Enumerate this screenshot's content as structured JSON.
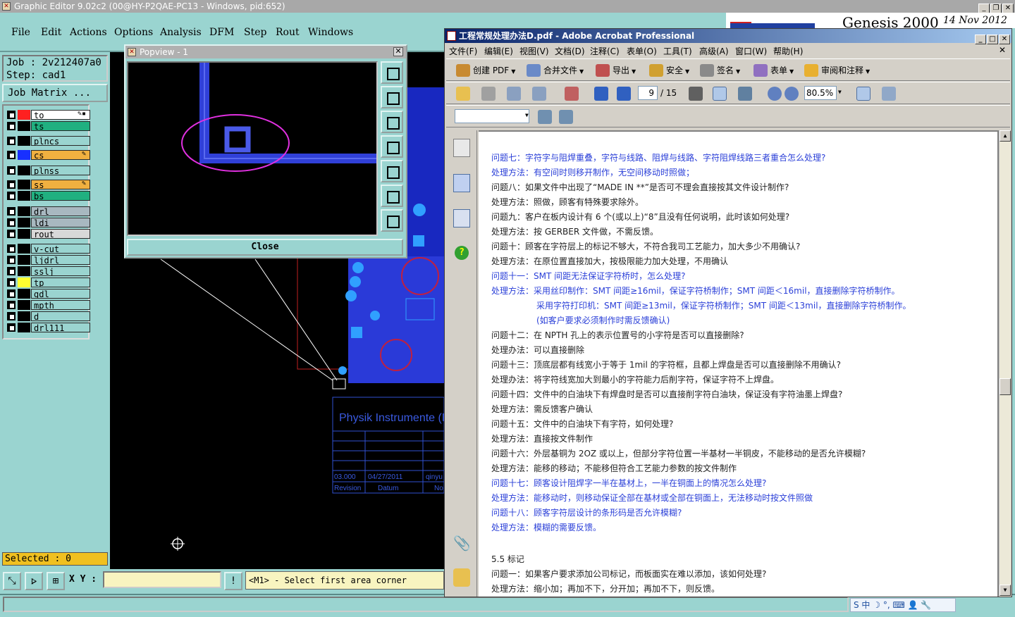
{
  "genesis": {
    "title": "Graphic Editor 9.02c2 (00@HY-P2QAE-PC13 - Windows, pid:652)",
    "menu": [
      "File",
      "Edit",
      "Actions",
      "Options",
      "Analysis",
      "DFM",
      "Step",
      "Rout",
      "Windows"
    ],
    "brand_name": "Genesis 2000",
    "brand_date": "14 Nov 2012",
    "job_label": "Job : 2v212407a0",
    "step_label": "Step: cad1",
    "job_matrix_button": "Job Matrix ...",
    "layers": [
      {
        "name": "to",
        "swatch": "#ff2020",
        "bg": "#ffffff",
        "edit": "✎▪"
      },
      {
        "name": "ts",
        "swatch": "#000000",
        "bg": "#20b080",
        "edit": ""
      },
      {
        "name": "plncs",
        "swatch": "#000000",
        "bg": "#9ad4d0",
        "edit": ""
      },
      {
        "name": "cs",
        "swatch": "#1830ff",
        "bg": "#f0b040",
        "edit": "✎"
      },
      {
        "name": "plnss",
        "swatch": "#000000",
        "bg": "#9ad4d0",
        "edit": ""
      },
      {
        "name": "ss",
        "swatch": "#000000",
        "bg": "#f0b040",
        "edit": "✎"
      },
      {
        "name": "bs",
        "swatch": "#000000",
        "bg": "#20b080",
        "edit": ""
      },
      {
        "name": "drl",
        "swatch": "#000000",
        "bg": "#a8b8c0",
        "edit": ""
      },
      {
        "name": "ldi",
        "swatch": "#000000",
        "bg": "#a8b8c0",
        "edit": ""
      },
      {
        "name": "rout",
        "swatch": "#000000",
        "bg": "#d8d8d8",
        "edit": ""
      },
      {
        "name": "v-cut",
        "swatch": "#000000",
        "bg": "#9ad4d0",
        "edit": ""
      },
      {
        "name": "ljdrl",
        "swatch": "#000000",
        "bg": "#9ad4d0",
        "edit": ""
      },
      {
        "name": "sslj",
        "swatch": "#000000",
        "bg": "#9ad4d0",
        "edit": ""
      },
      {
        "name": "tp",
        "swatch": "#ffff30",
        "bg": "#9ad4d0",
        "edit": ""
      },
      {
        "name": "gdl",
        "swatch": "#000000",
        "bg": "#9ad4d0",
        "edit": ""
      },
      {
        "name": "mpth",
        "swatch": "#000000",
        "bg": "#9ad4d0",
        "edit": ""
      },
      {
        "name": "d",
        "swatch": "#000000",
        "bg": "#9ad4d0",
        "edit": ""
      },
      {
        "name": "drl111",
        "swatch": "#000000",
        "bg": "#9ad4d0",
        "edit": ""
      }
    ],
    "selected": "Selected : 0",
    "xy_label": "X Y :",
    "xy_value": "",
    "status_message": "<M1> - Select first area corner",
    "canvas_text": {
      "company": "Physik Instrumente (P",
      "rev": "03.000",
      "date": "04/27/2011",
      "name": "qinyu",
      "revision_label": "Revision",
      "datum_label": "Datum",
      "no_label": "No"
    }
  },
  "popview": {
    "title": "Popview - 1",
    "close_label": "Close"
  },
  "acrobat": {
    "title": "工程常规处理办法D.pdf - Adobe Acrobat Professional",
    "menu": [
      "文件(F)",
      "编辑(E)",
      "视图(V)",
      "文档(D)",
      "注释(C)",
      "表单(O)",
      "工具(T)",
      "高级(A)",
      "窗口(W)",
      "帮助(H)"
    ],
    "toolbar1": [
      "创建 PDF",
      "合并文件",
      "导出",
      "安全",
      "签名",
      "表单",
      "审阅和注释"
    ],
    "page_current": "9",
    "page_total": "/ 15",
    "zoom": "80.5%",
    "doc_lines": [
      {
        "text": "问题七：字符字与阻焊重叠，字符与线路、阻焊与线路、字符阻焊线路三者重合怎么处理?",
        "color": "blue",
        "indent": 0
      },
      {
        "text": "处理方法：有空间时则移开制作，无空间移动时照做；",
        "color": "blue",
        "indent": 0
      },
      {
        "text": "问题八：如果文件中出现了“MADE IN **”是否可不理会直接按其文件设计制作?",
        "color": "black",
        "indent": 0
      },
      {
        "text": "处理方法：照做，顾客有特殊要求除外。",
        "color": "black",
        "indent": 0
      },
      {
        "text": "问题九：客户在板内设计有 6 个(或以上)“8”且没有任何说明，此时该如何处理?",
        "color": "black",
        "indent": 0
      },
      {
        "text": "处理方法：按 GERBER 文件做，不需反馈。",
        "color": "black",
        "indent": 0
      },
      {
        "text": "问题十：顾客在字符层上的标记不够大，不符合我司工艺能力，加大多少不用确认?",
        "color": "black",
        "indent": 0
      },
      {
        "text": "处理方法：在原位置直接加大，按极限能力加大处理，不用确认",
        "color": "black",
        "indent": 0
      },
      {
        "text": "问题十一：SMT 间距无法保证字符桥时，怎么处理?",
        "color": "blue",
        "indent": 0
      },
      {
        "text": "处理方法：采用丝印制作：SMT 间距≥16mil，保证字符桥制作；SMT 间距＜16mil，直接删除字符桥制作。",
        "color": "blue",
        "indent": 0
      },
      {
        "text": "采用字符打印机：SMT 间距≥13mil，保证字符桥制作；SMT 间距＜13mil，直接删除字符桥制作。",
        "color": "blue",
        "indent": 64
      },
      {
        "text": "(如客户要求必须制作时需反馈确认)",
        "color": "blue",
        "indent": 64
      },
      {
        "text": "问题十二：在 NPTH 孔上的表示位置号的小字符是否可以直接删除?",
        "color": "black",
        "indent": 0
      },
      {
        "text": "处理办法：可以直接删除",
        "color": "black",
        "indent": 0
      },
      {
        "text": "问题十三：顶底层都有线宽小于等于 1mil 的字符框，且都上焊盘是否可以直接删除不用确认?",
        "color": "black",
        "indent": 0
      },
      {
        "text": "处理办法：将字符线宽加大到最小的字符能力后削字符，保证字符不上焊盘。",
        "color": "black",
        "indent": 0
      },
      {
        "text": "问题十四：文件中的白油块下有焊盘时是否可以直接削字符白油块，保证没有字符油墨上焊盘?",
        "color": "black",
        "indent": 0
      },
      {
        "text": "处理方法：需反馈客户确认",
        "color": "black",
        "indent": 0
      },
      {
        "text": "问题十五：文件中的白油块下有字符，如何处理?",
        "color": "black",
        "indent": 0
      },
      {
        "text": "处理方法：直接按文件制作",
        "color": "black",
        "indent": 0
      },
      {
        "text": "问题十六：外层基铜为 2OZ 或以上，但部分字符位置一半基材一半铜皮，不能移动的是否允许模糊?",
        "color": "black",
        "indent": 0
      },
      {
        "text": "处理方法：能移的移动；不能移但符合工艺能力参数的按文件制作",
        "color": "black",
        "indent": 0
      },
      {
        "text": "问题十七：顾客设计阻焊字一半在基材上，一半在铜面上的情况怎么处理?",
        "color": "blue",
        "indent": 0
      },
      {
        "text": "处理方法：能移动时，则移动保证全部在基材或全部在铜面上，无法移动时按文件照做",
        "color": "blue",
        "indent": 0
      },
      {
        "text": "问题十八：顾客字符层设计的条形码是否允许模糊?",
        "color": "blue",
        "indent": 0
      },
      {
        "text": "处理方法：模糊的需要反馈。",
        "color": "blue",
        "indent": 0
      },
      {
        "text": "",
        "color": "black",
        "indent": 0
      },
      {
        "text": "5.5 标记",
        "color": "black",
        "indent": 0
      },
      {
        "text": "问题一：如果客户要求添加公司标记，而板面实在难以添加，该如何处理?",
        "color": "black",
        "indent": 0
      },
      {
        "text": "处理方法：缩小加；再加不下，分开加；再加不下，则反馈。",
        "color": "black",
        "indent": 0
      }
    ]
  },
  "ime": {
    "label": "S 中 ☽ °, ⌨ 👤 🔧"
  }
}
